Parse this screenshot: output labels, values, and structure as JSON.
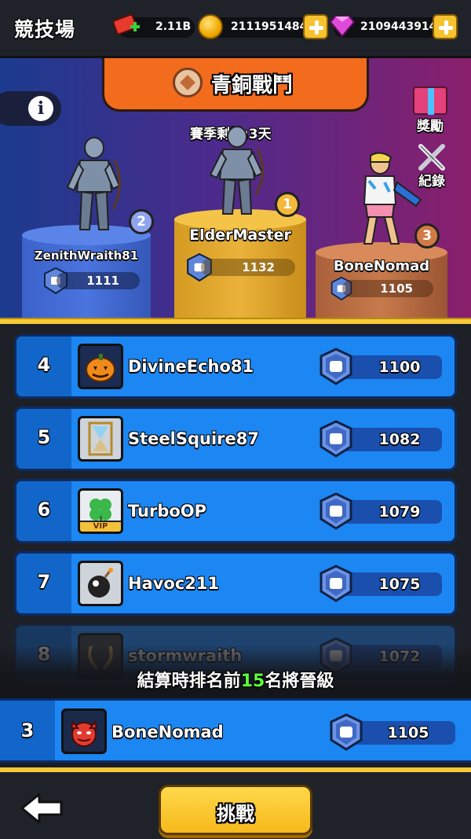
{
  "header": {
    "title": "競技場",
    "tickets": "2.11B",
    "gold": "2111951484",
    "gems": "2109443914"
  },
  "arena": {
    "tier": "青銅戰鬥",
    "season_remaining": "賽季剩餘:3天",
    "rewards_label": "獎勵",
    "record_label": "紀錄",
    "info_glyph": "i"
  },
  "podium": [
    {
      "rank": "1",
      "name": "ElderMaster",
      "score": "1132"
    },
    {
      "rank": "2",
      "name": "ZenithWraith81",
      "score": "1111"
    },
    {
      "rank": "3",
      "name": "BoneNomad",
      "score": "1105"
    }
  ],
  "leaderboard": [
    {
      "rank": "4",
      "name": "DivineEcho81",
      "score": "1100",
      "avatar": "pumpkin-icon"
    },
    {
      "rank": "5",
      "name": "SteelSquire87",
      "score": "1082",
      "avatar": "hourglass-icon"
    },
    {
      "rank": "6",
      "name": "TurboOP",
      "score": "1079",
      "avatar": "clover-icon",
      "badge": "VIP"
    },
    {
      "rank": "7",
      "name": "Havoc211",
      "score": "1075",
      "avatar": "bomb-icon"
    },
    {
      "rank": "8",
      "name": "stormwraith",
      "score": "1072",
      "avatar": "laurel-icon"
    }
  ],
  "promotion": {
    "before": "結算時排名前",
    "number": "15",
    "after": "名將晉級"
  },
  "me": {
    "rank": "3",
    "name": "BoneNomad",
    "score": "1105",
    "avatar": "devil-icon"
  },
  "footer": {
    "challenge_label": "挑戰"
  },
  "colors": {
    "row_blue": "#1c86f2",
    "gold_accent": "#f6c93a",
    "promo_highlight": "#5cff3c"
  }
}
